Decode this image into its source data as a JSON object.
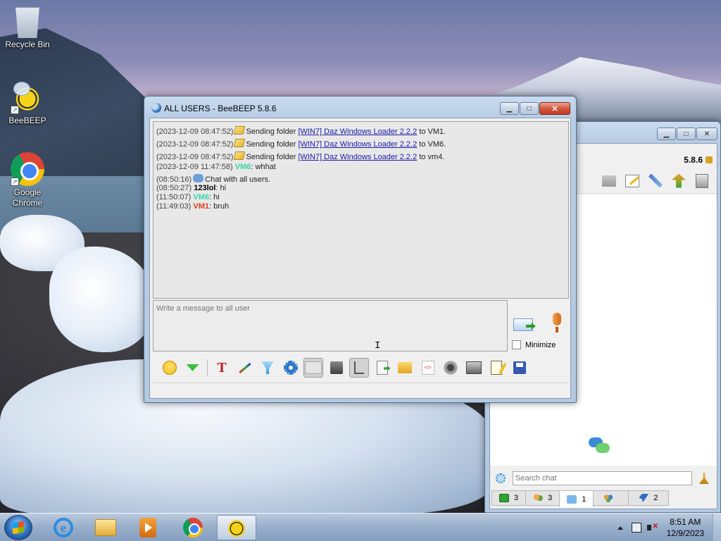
{
  "desktop": {
    "icons": [
      {
        "label": "Recycle Bin",
        "icon": "recycle-bin-icon"
      },
      {
        "label": "BeeBEEP",
        "icon": "beebeep-icon"
      },
      {
        "label": "Google Chrome",
        "icon": "chrome-icon"
      }
    ]
  },
  "chat_window": {
    "title": "ALL USERS - BeeBEEP 5.8.6",
    "caption": {
      "minimize": "▁",
      "maximize": "□",
      "close": "✕"
    },
    "messages": [
      {
        "time": "(2023-12-09 08:47:52)",
        "text": "Sending folder",
        "link": "[WIN7] Daz Windows Loader 2.2.2",
        "suffix": "to VM1."
      },
      {
        "time": "(2023-12-09 08:47:52)",
        "text": "Sending folder",
        "link": "[WIN7] Daz Windows Loader 2.2.2",
        "suffix": "to VM6."
      },
      {
        "time": "(2023-12-09 08:47:52)",
        "text": "Sending folder",
        "link": "[WIN7] Daz Windows Loader 2.2.2",
        "suffix": "to vm4."
      },
      {
        "time": "(2023-12-09 11:47:58)",
        "user": "VM6",
        "text": ": whhat"
      },
      {
        "time": "(08:50:16)",
        "text": "Chat with all users."
      },
      {
        "time": "(08:50:27)",
        "user": "123lol",
        "text": ": hi"
      },
      {
        "time": "(11:50:07)",
        "user": "VM6",
        "text": ": hi"
      },
      {
        "time": "(11:49:03)",
        "user": "VM1",
        "text": ": bruh"
      }
    ],
    "compose_placeholder": "Write a message to all user",
    "minimize_label": "Minimize",
    "toolbar_icons": [
      "emoticon-icon",
      "green-arrow-icon",
      "font-icon",
      "color-pen-icon",
      "filter-icon",
      "settings-icon",
      "spellcheck-icon",
      "dark-icon",
      "note-icon",
      "send-file-icon",
      "send-folder-icon",
      "html-code-icon",
      "record-icon",
      "screenshot-icon",
      "notepad-icon",
      "save-icon"
    ]
  },
  "main_window": {
    "version": "5.8.6",
    "search_placeholder": "Search chat",
    "tabs": [
      {
        "icon": "users-online-icon",
        "count": "3"
      },
      {
        "icon": "users-icon",
        "count": "3"
      },
      {
        "icon": "chats-icon",
        "count": "1"
      },
      {
        "icon": "groups-icon",
        "count": ""
      },
      {
        "icon": "pin-icon",
        "count": "2"
      }
    ]
  },
  "taskbar": {
    "apps": [
      "internet-explorer-icon",
      "file-explorer-icon",
      "media-player-icon",
      "chrome-icon",
      "beebeep-icon"
    ],
    "time": "8:51 AM",
    "date": "12/9/2023"
  },
  "colors": {
    "vm6": "#33d6a8",
    "vm1": "#e0381d",
    "link": "#1a1aa8"
  }
}
